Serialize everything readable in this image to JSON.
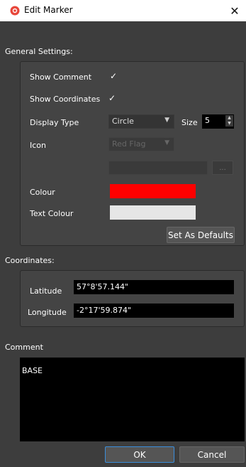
{
  "window": {
    "title": "Edit Marker",
    "close_glyph": "✕"
  },
  "general": {
    "heading": "General Settings:",
    "show_comment_label": "Show Comment",
    "show_comment_checked": "✓",
    "show_coordinates_label": "Show Coordinates",
    "show_coordinates_checked": "✓",
    "display_type_label": "Display Type",
    "display_type_value": "Circle",
    "size_label": "Size",
    "size_value": "5",
    "icon_label": "Icon",
    "icon_value": "Red Flag",
    "browse_label": "...",
    "colour_label": "Colour",
    "colour_value": "#ff0000",
    "text_colour_label": "Text Colour",
    "text_colour_value": "#e6e6e6",
    "defaults_button": "Set As Defaults"
  },
  "coordinates": {
    "heading": "Coordinates:",
    "latitude_label": "Latitude",
    "latitude_value": "57°8'57.144\"",
    "longitude_label": "Longitude",
    "longitude_value": "-2°17'59.874\""
  },
  "comment": {
    "heading": "Comment",
    "value": "BASE"
  },
  "buttons": {
    "ok": "OK",
    "cancel": "Cancel"
  },
  "icons": {
    "app": "app-logo-icon",
    "dropdown": "chevron-down-icon"
  }
}
